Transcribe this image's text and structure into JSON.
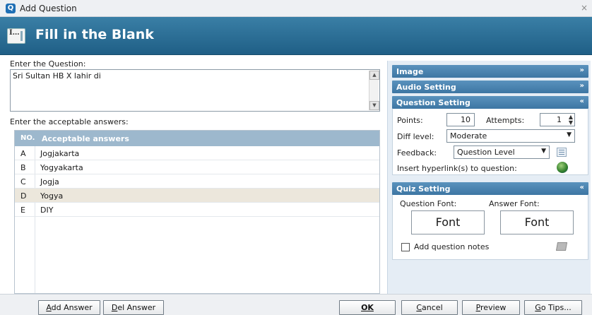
{
  "window": {
    "title": "Add Question",
    "close_glyph": "×"
  },
  "banner": {
    "title": "Fill in the Blank",
    "icon": "fill-in-blank-icon"
  },
  "question": {
    "label": "Enter the Question:",
    "value": "Sri Sultan HB X lahir di"
  },
  "answers": {
    "label": "Enter the acceptable answers:",
    "headers": {
      "no": "NO.",
      "answer": "Acceptable answers"
    },
    "rows": [
      {
        "no": "A",
        "answer": "Jogjakarta"
      },
      {
        "no": "B",
        "answer": "Yogyakarta"
      },
      {
        "no": "C",
        "answer": "Jogja"
      },
      {
        "no": "D",
        "answer": "Yogya"
      },
      {
        "no": "E",
        "answer": "DIY"
      }
    ],
    "selected_row": "D"
  },
  "panels": {
    "image": {
      "title": "Image"
    },
    "audio": {
      "title": "Audio Setting"
    },
    "question_setting": {
      "title": "Question Setting",
      "points_label": "Points:",
      "points_value": "10",
      "attempts_label": "Attempts:",
      "attempts_value": "1",
      "diff_label": "Diff level:",
      "diff_value": "Moderate",
      "feedback_label": "Feedback:",
      "feedback_value": "Question Level",
      "hyperlink_label": "Insert hyperlink(s) to question:"
    },
    "quiz_setting": {
      "title": "Quiz Setting",
      "question_font_label": "Question Font:",
      "answer_font_label": "Answer Font:",
      "question_font_button": "Font",
      "answer_font_button": "Font",
      "notes_label": "Add question notes"
    }
  },
  "buttons": {
    "add_answer": {
      "underline": "A",
      "rest": "dd Answer"
    },
    "del_answer": {
      "underline": "D",
      "rest": "el Answer"
    },
    "ok": {
      "underline": "OK",
      "rest": ""
    },
    "cancel": {
      "underline": "C",
      "rest": "ancel"
    },
    "preview": {
      "underline": "P",
      "rest": "review"
    },
    "go_tips": {
      "underline": "G",
      "rest": "o Tips..."
    }
  },
  "colors": {
    "banner": "#2b6d95",
    "panel_header": "#4a85b1",
    "table_header": "#9db8cd",
    "selected_row": "#ece7dc"
  }
}
